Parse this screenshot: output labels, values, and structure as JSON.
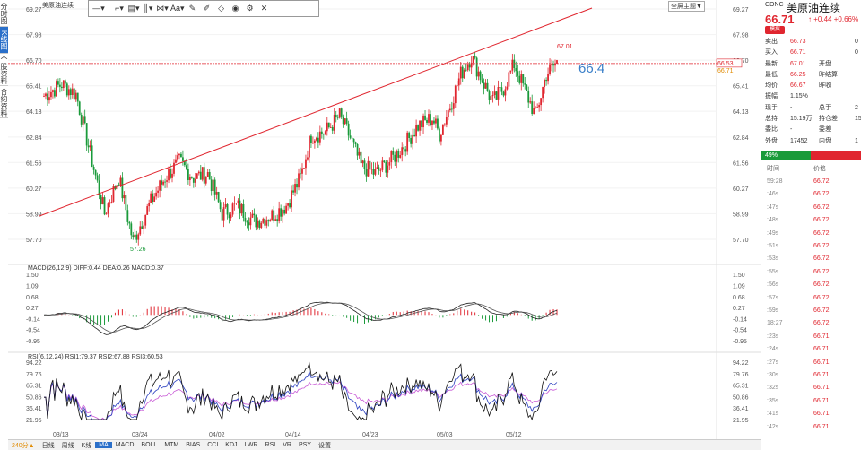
{
  "left_tabs": [
    "分时图",
    "K线图",
    "个股资料",
    "合约资料"
  ],
  "chart": {
    "title": "美原油连续",
    "toolbar_items": [
      "line-tool-icon",
      "ray-tool-icon",
      "channel-tool-icon",
      "fib-tool-icon",
      "pattern-tool-icon",
      "text-tool-icon",
      "pen-icon",
      "brush-icon",
      "eraser-icon",
      "eye-icon",
      "settings-icon",
      "close-icon"
    ],
    "fullscreen_label": "全屏主题▼",
    "price_axis": [
      "69.27",
      "67.98",
      "66.70",
      "65.41",
      "64.13",
      "62.84",
      "61.56",
      "60.27",
      "58.99",
      "57.70"
    ],
    "current_price_label": "66.53",
    "current_price_sub": "66.71",
    "high_label": "67.01",
    "low_label": "57.26",
    "annotation": "66.4",
    "macd_label": "MACD(26,12,9) DIFF:0.44 DEA:0.26 MACD:0.37",
    "macd_axis": [
      "1.50",
      "1.09",
      "0.68",
      "0.27",
      "-0.14",
      "-0.54",
      "-0.95"
    ],
    "rsi_label": "RSI(6,12,24) RSI1:79.37 RSI2:67.88 RSI3:60.53",
    "rsi_axis": [
      "94.22",
      "79.76",
      "65.31",
      "50.86",
      "36.41",
      "21.95"
    ],
    "date_labels": [
      "03/13",
      "03/24",
      "04/02",
      "04/14",
      "04/23",
      "05/03",
      "05/12"
    ],
    "bottom_tabs": [
      "日线",
      "周线",
      "K线",
      "MA",
      "MACD",
      "BOLL",
      "MTM",
      "BIAS",
      "CCI",
      "KDJ",
      "LWR",
      "RSI",
      "VR",
      "PSY",
      "设置"
    ],
    "colors": {
      "up": "#e0262f",
      "down": "#1a9a3a",
      "trendline": "#e0262f",
      "accent": "#2a6fc9"
    }
  },
  "quote": {
    "code": "CONC",
    "name": "美原油连续",
    "price": "66.71",
    "arrow": "↑",
    "change": "+0.44",
    "change_pct": "+0.66%",
    "tag": "模拟",
    "rows": [
      {
        "l1": "卖出",
        "v1": "66.73",
        "l2": "",
        "v2": "0"
      },
      {
        "l1": "买入",
        "v1": "66.71",
        "l2": "",
        "v2": "0"
      },
      {
        "l1": "最新",
        "v1": "67.01",
        "l2": "开盘",
        "v2": ""
      },
      {
        "l1": "最低",
        "v1": "66.25",
        "l2": "昨结算",
        "v2": ""
      },
      {
        "l1": "均价",
        "v1": "66.67",
        "l2": "昨收",
        "v2": ""
      },
      {
        "l1": "振幅",
        "v1": "1.15%",
        "l2": "",
        "v2": ""
      },
      {
        "l1": "现手",
        "v1": "-",
        "l2": "总手",
        "v2": "2"
      },
      {
        "l1": "总持",
        "v1": "15.19万",
        "l2": "持仓差",
        "v2": "15"
      },
      {
        "l1": "委比",
        "v1": "-",
        "l2": "委差",
        "v2": ""
      },
      {
        "l1": "外盘",
        "v1": "17452",
        "l2": "内盘",
        "v2": "1"
      }
    ],
    "ratio": "49%",
    "tick_header": [
      "时间",
      "价格"
    ],
    "ticks": [
      {
        "t": "59:28",
        "p": "66.72"
      },
      {
        "t": ":46s",
        "p": "66.72"
      },
      {
        "t": ":47s",
        "p": "66.72"
      },
      {
        "t": ":48s",
        "p": "66.72"
      },
      {
        "t": ":49s",
        "p": "66.72"
      },
      {
        "t": ":51s",
        "p": "66.72"
      },
      {
        "t": ":53s",
        "p": "66.72"
      },
      {
        "t": ":55s",
        "p": "66.72"
      },
      {
        "t": ":56s",
        "p": "66.72"
      },
      {
        "t": ":57s",
        "p": "66.72"
      },
      {
        "t": ":59s",
        "p": "66.72"
      },
      {
        "t": "18:27",
        "p": "66.72"
      },
      {
        "t": ":23s",
        "p": "66.71"
      },
      {
        "t": ":24s",
        "p": "66.71"
      },
      {
        "t": ":27s",
        "p": "66.71"
      },
      {
        "t": ":30s",
        "p": "66.71"
      },
      {
        "t": ":32s",
        "p": "66.71"
      },
      {
        "t": ":35s",
        "p": "66.71"
      },
      {
        "t": ":41s",
        "p": "66.71"
      },
      {
        "t": ":42s",
        "p": "66.71"
      }
    ]
  }
}
